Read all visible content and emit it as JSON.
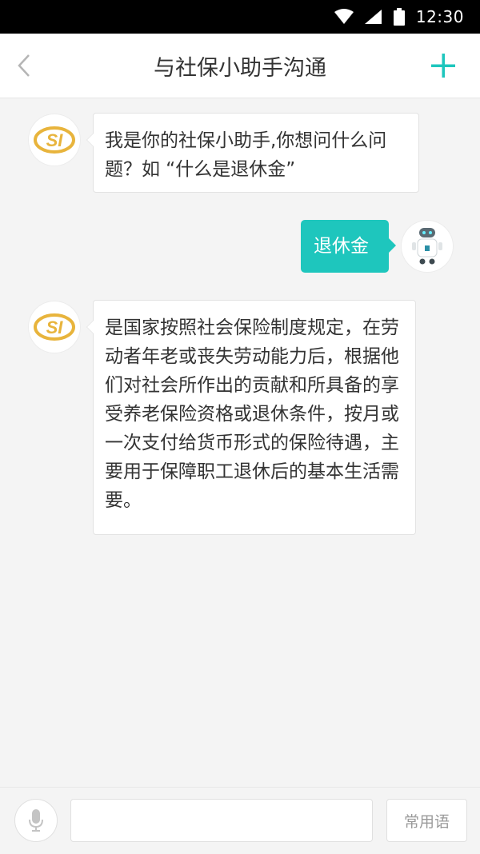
{
  "status_bar": {
    "time": "12:30",
    "icons": [
      "wifi-icon",
      "signal-icon",
      "battery-icon"
    ]
  },
  "header": {
    "back_icon": "chevron-left-icon",
    "title": "与社保小助手沟通",
    "add_icon": "plus-icon",
    "accent_color": "#1ec6bd"
  },
  "messages": [
    {
      "sender": "assistant",
      "avatar": "si-logo-icon",
      "text": "我是你的社保小助手,你想问什么问题？如 “什么是退休金”"
    },
    {
      "sender": "user",
      "avatar": "robot-avatar-icon",
      "text": "退休金"
    },
    {
      "sender": "assistant",
      "avatar": "si-logo-icon",
      "text": "是国家按照社会保险制度规定，在劳动者年老或丧失劳动能力后，根据他们对社会所作出的贡献和所具备的享受养老保险资格或退休条件，按月或一次支付给货币形式的保险待遇，主要用于保障职工退休后的基本生活需要。"
    }
  ],
  "input_bar": {
    "mic_icon": "microphone-icon",
    "input_value": "",
    "phrases_label": "常用语"
  }
}
